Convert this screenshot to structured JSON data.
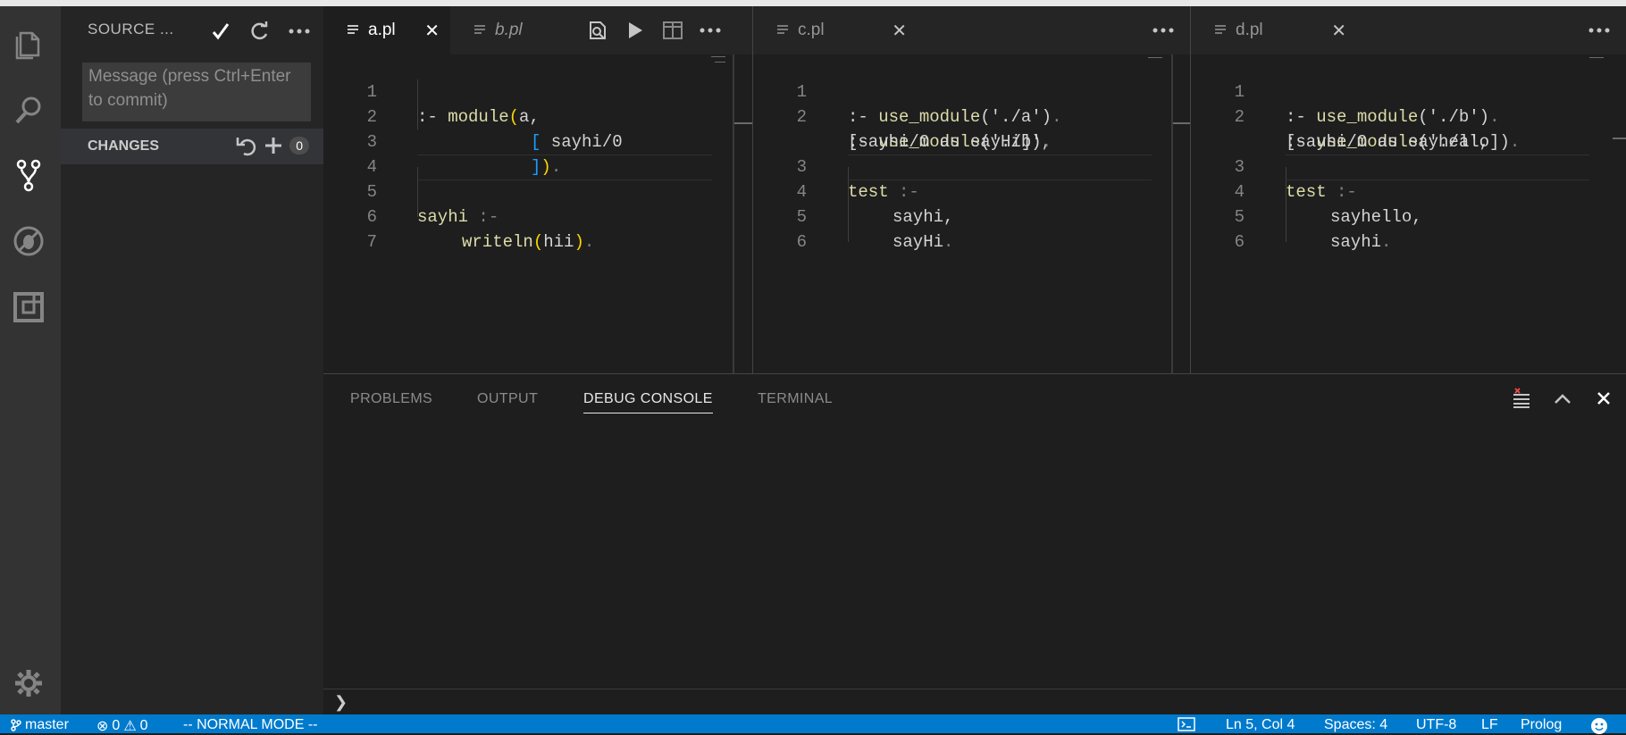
{
  "sidebar": {
    "title": "SOURCE ...",
    "commit_placeholder": "Message (press Ctrl+Enter to commit)",
    "changes_label": "CHANGES",
    "changes_count": "0"
  },
  "editors": [
    {
      "tabs": [
        {
          "label": "a.pl",
          "active": true
        },
        {
          "label": "b.pl",
          "active": false
        }
      ]
    },
    {
      "tabs": [
        {
          "label": "c.pl",
          "active": true
        }
      ]
    },
    {
      "tabs": [
        {
          "label": "d.pl",
          "active": true
        }
      ]
    }
  ],
  "code": {
    "a": [
      {
        "n": "1",
        "text": ":- module(a,"
      },
      {
        "n": "2",
        "text": "[ sayhi/0"
      },
      {
        "n": "3",
        "text": "])."
      },
      {
        "n": "4",
        "text": ""
      },
      {
        "n": "5",
        "text": "sayhi :-"
      },
      {
        "n": "6",
        "text": "writeln(hii)."
      },
      {
        "n": "7",
        "text": ""
      }
    ],
    "c": [
      {
        "n": "1",
        "text": ":- use_module('./a')."
      },
      {
        "n": "2",
        "text": ":- use_module('./b',"
      },
      {
        "n": "",
        "text": "[sayhi/0 as sayHi])."
      },
      {
        "n": "3",
        "text": "test :-"
      },
      {
        "n": "4",
        "text": "sayhi,"
      },
      {
        "n": "5",
        "text": "sayHi."
      },
      {
        "n": "6",
        "text": ""
      }
    ],
    "d": [
      {
        "n": "1",
        "text": ":- use_module('./b')."
      },
      {
        "n": "2",
        "text": ":- use_module('./a',"
      },
      {
        "n": "",
        "text": "[sayhi/0 as sayhello])."
      },
      {
        "n": "3",
        "text": "test :-"
      },
      {
        "n": "4",
        "text": "sayhello,"
      },
      {
        "n": "5",
        "text": "sayhi."
      },
      {
        "n": "6",
        "text": ""
      }
    ]
  },
  "panel": {
    "tabs": [
      "PROBLEMS",
      "OUTPUT",
      "DEBUG CONSOLE",
      "TERMINAL"
    ],
    "active_tab": "DEBUG CONSOLE",
    "prompt": "❯"
  },
  "status": {
    "branch": "master",
    "errors": "0",
    "warnings": "0",
    "mode": "-- NORMAL MODE --",
    "position": "Ln 5, Col 4",
    "spaces": "Spaces: 4",
    "encoding": "UTF-8",
    "eol": "LF",
    "language": "Prolog"
  },
  "colors": {
    "status_bar": "#007acc",
    "activity_bar": "#333333",
    "sidebar": "#252526",
    "editor": "#1e1e1e"
  }
}
